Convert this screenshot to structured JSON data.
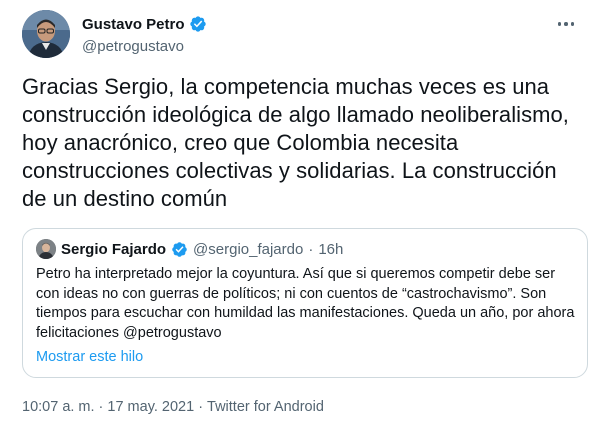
{
  "author": {
    "display_name": "Gustavo Petro",
    "handle": "@petrogustavo",
    "avatar": "profile-photo",
    "verified": true
  },
  "more_icon": "more-horizontal-icon",
  "tweet_text": "Gracias Sergio, la competencia muchas veces es una construcción ideológica de algo llamado neoliberalismo, hoy anacrónico, creo que Colombia necesita construcciones colectivas y solidarias. La construcción de un destino común",
  "quoted": {
    "display_name": "Sergio Fajardo",
    "handle": "@sergio_fajardo",
    "separator": "·",
    "time": "16h",
    "verified": true,
    "text": "Petro ha interpretado mejor la coyuntura. Así que si queremos competir debe ser con ideas no con guerras de políticos; ni con cuentos de “castrochavismo”. Son tiempos para escuchar con humildad las manifestaciones. Queda un año, por ahora felicitaciones @petrogustavo",
    "show_thread": "Mostrar este hilo"
  },
  "meta": {
    "time": "10:07 a. m.",
    "separator1": "·",
    "date": "17 may. 2021",
    "separator2": "·",
    "source": "Twitter for Android"
  },
  "colors": {
    "verified_blue": "#1d9bf0",
    "link_blue": "#1d9bf0",
    "secondary_text": "#536471",
    "border": "#cfd9de"
  }
}
